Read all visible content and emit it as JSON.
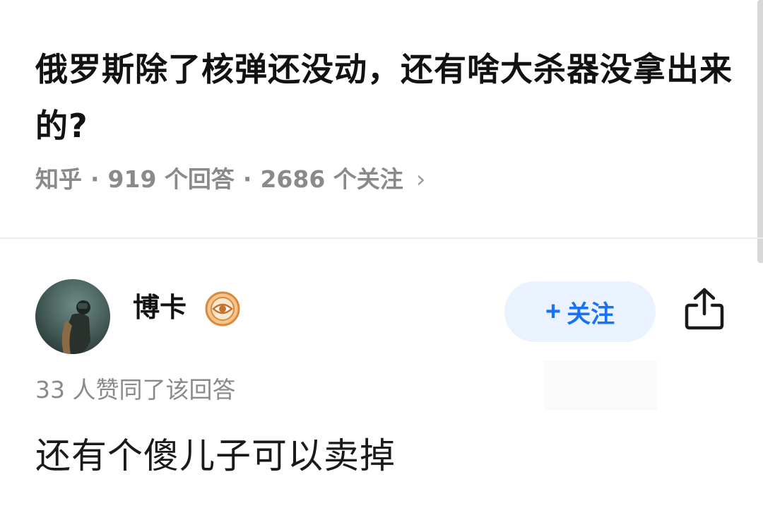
{
  "question": {
    "title": "俄罗斯除了核弹还没动，还有啥大杀器没拿出来的?",
    "source": "知乎",
    "answers": "919 个回答",
    "followers": "2686 个关注",
    "chevron": "›"
  },
  "author": {
    "name": "博卡",
    "follow_plus": "+",
    "follow_label": "关注"
  },
  "answer": {
    "votes": "33 人赞同了该回答",
    "text": "还有个傻儿子可以卖掉"
  },
  "colors": {
    "accent": "#1772f6",
    "follow_bg": "#eaf2ff",
    "meta_gray": "#8a8a8a",
    "badge_orange": "#d98a3a"
  },
  "icons": {
    "share": "share-icon",
    "badge": "eye-badge-icon",
    "chevron": "chevron-right-icon"
  }
}
